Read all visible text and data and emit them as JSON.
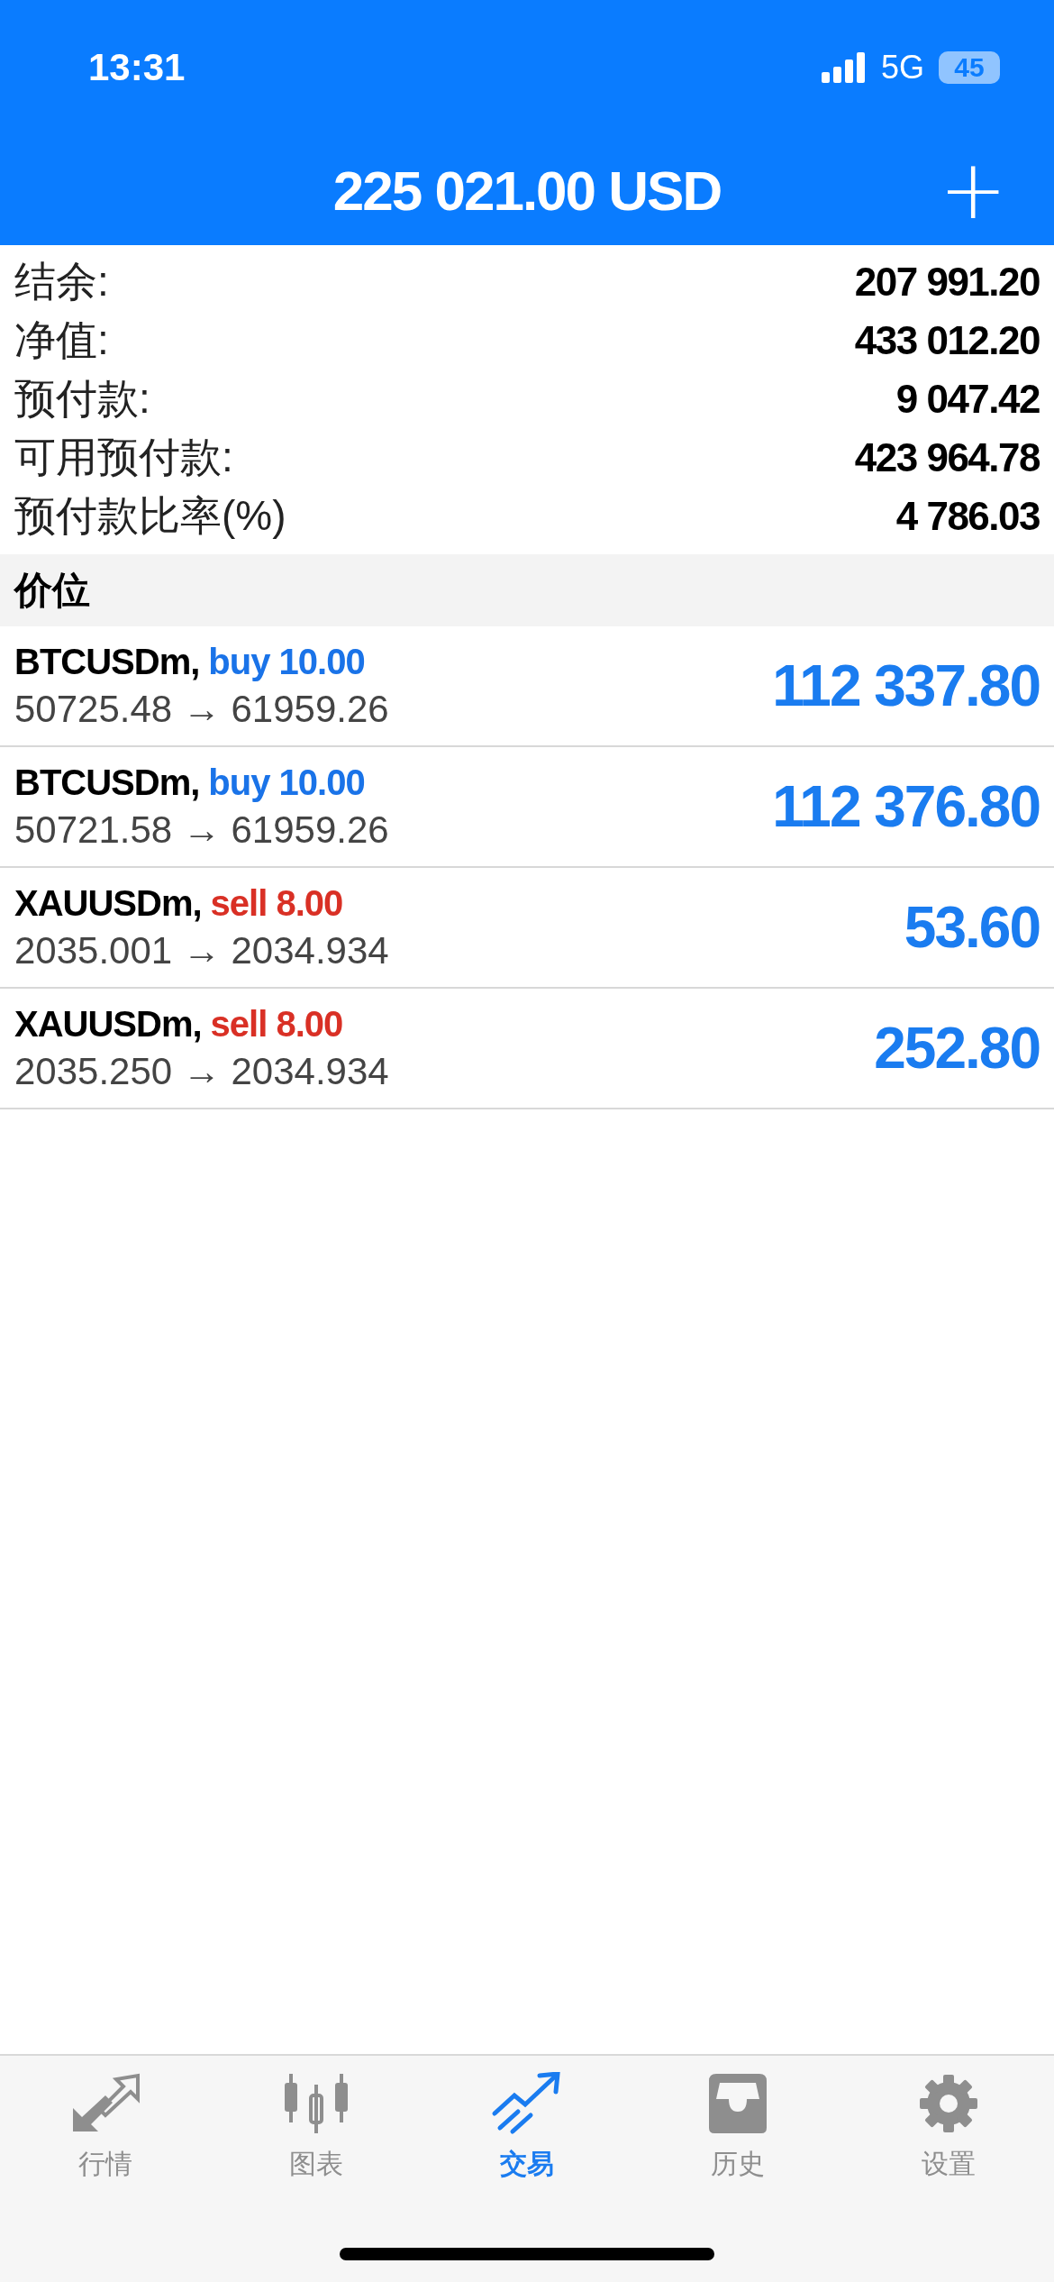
{
  "status_bar": {
    "time": "13:31",
    "network": "5G",
    "battery": "45"
  },
  "header": {
    "title": "225 021.00 USD",
    "add_button": "+"
  },
  "summary": [
    {
      "label": "结余:",
      "value": "207 991.20"
    },
    {
      "label": "净值:",
      "value": "433 012.20"
    },
    {
      "label": "预付款:",
      "value": "9 047.42"
    },
    {
      "label": "可用预付款:",
      "value": "423 964.78"
    },
    {
      "label": "预付款比率(%)",
      "value": "4 786.03"
    }
  ],
  "section_title": "价位",
  "positions": [
    {
      "symbol": "BTCUSDm,",
      "side": "buy",
      "volume": "10.00",
      "color": "#1a73e8",
      "prices": "50725.48 → 61959.26",
      "profit": "112 337.80"
    },
    {
      "symbol": "BTCUSDm,",
      "side": "buy",
      "volume": "10.00",
      "color": "#1a73e8",
      "prices": "50721.58 → 61959.26",
      "profit": "112 376.80"
    },
    {
      "symbol": "XAUUSDm,",
      "side": "sell",
      "volume": "8.00",
      "color": "#d93025",
      "prices": "2035.001 → 2034.934",
      "profit": "53.60"
    },
    {
      "symbol": "XAUUSDm,",
      "side": "sell",
      "volume": "8.00",
      "color": "#d93025",
      "prices": "2035.250 → 2034.934",
      "profit": "252.80"
    }
  ],
  "tab_bar": [
    {
      "kind": "quotes",
      "label": "行情",
      "selected": false
    },
    {
      "kind": "chart",
      "label": "图表",
      "selected": false
    },
    {
      "kind": "trade",
      "label": "交易",
      "selected": true
    },
    {
      "kind": "history",
      "label": "历史",
      "selected": false
    },
    {
      "kind": "settings",
      "label": "设置",
      "selected": false
    }
  ]
}
